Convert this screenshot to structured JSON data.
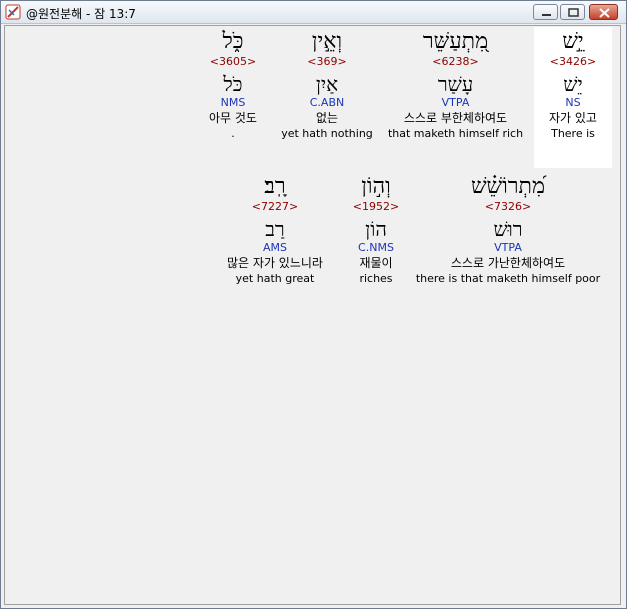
{
  "window": {
    "title": "@원전분해 - 잠 13:7",
    "icon": "app-icon"
  },
  "verse_rows": [
    {
      "words": [
        {
          "hebrew": "יֵ֣שׁ",
          "strong": "<3426>",
          "lemma": "יֵשׁ",
          "morph": "NS",
          "korean": "자가 있고",
          "english": "There is"
        },
        {
          "hebrew": "מִ֭תְעַשֵּׁר",
          "strong": "<6238>",
          "lemma": "עָשַׁר",
          "morph": "VTPA",
          "korean": "스스로 부한체하여도",
          "english": "that maketh himself rich"
        },
        {
          "hebrew": "וְאֵ֣ין",
          "strong": "<369>",
          "lemma": "אַיִן",
          "morph": "C.ABN",
          "korean": "없는",
          "english": "yet hath nothing"
        },
        {
          "hebrew": "כֹּ֑ל",
          "strong": "<3605>",
          "lemma": "כֹּל",
          "morph": "NMS",
          "korean": "아무 것도",
          "english": "."
        }
      ]
    },
    {
      "words": [
        {
          "hebrew": "מִ֝תְרוֹשֵׁ֗שׁ",
          "strong": "<7326>",
          "lemma": "רוּשׁ",
          "morph": "VTPA",
          "korean": "스스로 가난한체하여도",
          "english": "there is that maketh himself poor"
        },
        {
          "hebrew": "וְה֣וֹן",
          "strong": "<1952>",
          "lemma": "הוֹן",
          "morph": "C.NMS",
          "korean": "재물이",
          "english": "riches"
        },
        {
          "hebrew": "רָֽב׃",
          "strong": "<7227>",
          "lemma": "רַב",
          "morph": "AMS",
          "korean": "많은 자가 있느니라",
          "english": "yet hath great"
        }
      ]
    }
  ]
}
